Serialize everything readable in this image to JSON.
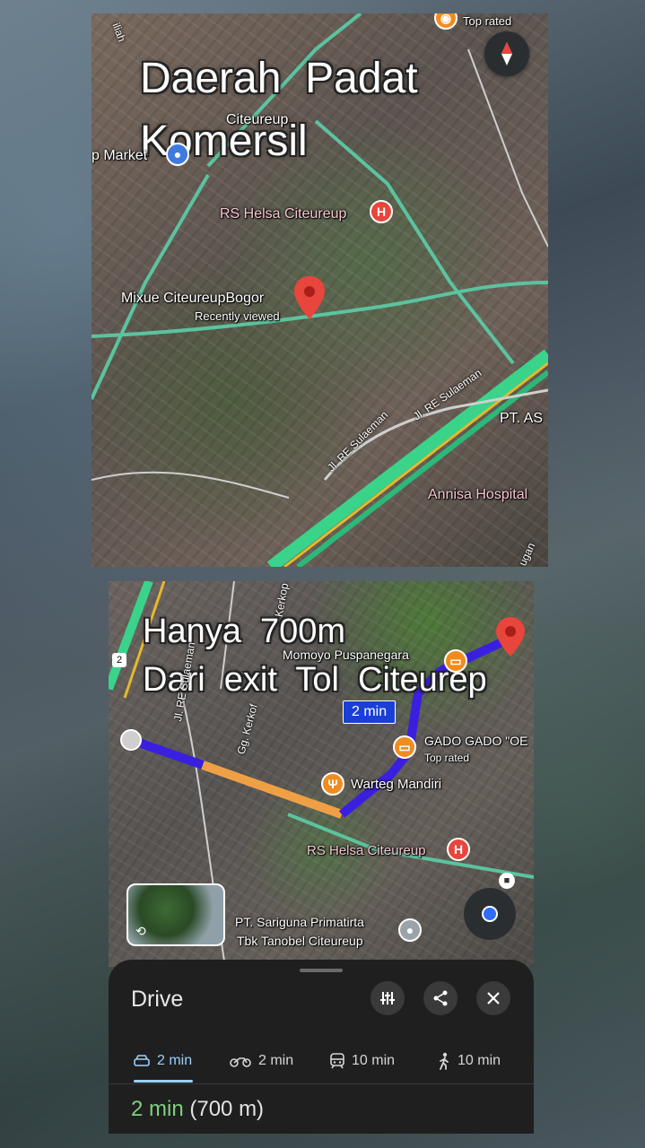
{
  "top_map": {
    "title_line1": "Daerah  Padat",
    "title_line2": "Komersil",
    "labels": {
      "top_rated": "Top rated",
      "iliah": "iliah",
      "citeureup": "Citeureup",
      "market": "p Market",
      "rs_helsa": "RS Helsa Citeureup",
      "mixue": "Mixue CiteureupBogor",
      "recently_viewed": "Recently viewed",
      "road1": "Jl. RE Sulaeman",
      "road2": "Jl. RE Sulaeman",
      "pt_as": "PT. AS",
      "annisa": "Annisa Hospital",
      "ugan": "ugan"
    }
  },
  "bottom_map": {
    "title_line1": "Hanya  700m",
    "title_line2": "Dari  exit  Tol  Citeurep",
    "route_badge": "2 min",
    "labels": {
      "momoyo": "Momoyo Puspanegara",
      "gado": "GADO GADO \"OE",
      "top_rated": "Top rated",
      "warteg": "Warteg Mandiri",
      "rs_helsa": "RS Helsa Citeureup",
      "pt_sariguna_1": "PT. Sariguna Primatirta",
      "pt_sariguna_2": "Tbk Tanobel Citeureup",
      "road_re": "Jl. RE Sulaeman",
      "road_kerkof": "Gg. Kerkof",
      "road_kerkop": "Kerkop",
      "shield": "2"
    }
  },
  "sheet": {
    "title": "Drive",
    "modes": [
      {
        "icon": "car-icon",
        "label": "2 min"
      },
      {
        "icon": "motorcycle-icon",
        "label": "2 min"
      },
      {
        "icon": "transit-icon",
        "label": "10 min"
      },
      {
        "icon": "walk-icon",
        "label": "10 min"
      }
    ],
    "summary_time": "2 min",
    "summary_distance": "(700 m)"
  },
  "colors": {
    "route_blue": "#3b1fe0",
    "route_orange": "#f0a044",
    "highway_green": "#3ad38a",
    "pin_red": "#e8453c",
    "active_blue": "#9ad0ff",
    "time_green": "#7fd17f"
  }
}
